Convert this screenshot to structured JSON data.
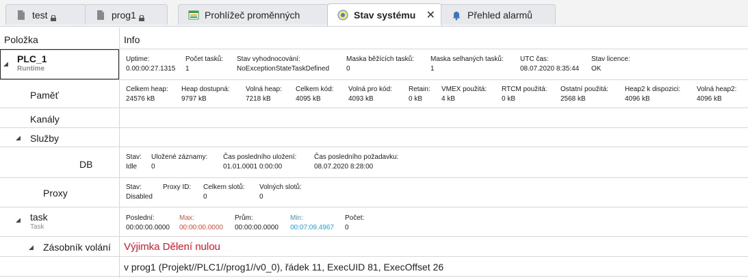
{
  "tabs": [
    {
      "label": "test",
      "locked": true
    },
    {
      "label": "prog1",
      "locked": true
    },
    {
      "label": "Prohlížeč proměnných"
    },
    {
      "label": "Stav systému",
      "active": true
    },
    {
      "label": "Přehled alarmů"
    }
  ],
  "header": {
    "col1": "Položka",
    "col2": "Info"
  },
  "plc": {
    "name": "PLC_1",
    "sub": "Runtime",
    "fields": [
      {
        "label": "Uptime:",
        "value": "0.00:00:27.1315"
      },
      {
        "label": "Počet tasků:",
        "value": "1"
      },
      {
        "label": "Stav vyhodnocování:",
        "value": "NoExceptionStateTaskDefined"
      },
      {
        "label": "Maska běžících tasků:",
        "value": "0"
      },
      {
        "label": "Maska selhaných tasků:",
        "value": "1"
      },
      {
        "label": "UTC čas:",
        "value": "08.07.2020 8:35:44"
      },
      {
        "label": "Stav licence:",
        "value": "OK"
      }
    ]
  },
  "memory": {
    "name": "Paměť",
    "fields": [
      {
        "label": "Celkem heap:",
        "value": "24576 kB"
      },
      {
        "label": "Heap dostupná:",
        "value": "9797 kB"
      },
      {
        "label": "Volná heap:",
        "value": "7218 kB"
      },
      {
        "label": "Celkem kód:",
        "value": "4095 kB"
      },
      {
        "label": "Volná pro kód:",
        "value": "4093 kB"
      },
      {
        "label": "Retain:",
        "value": "0 kB"
      },
      {
        "label": "VMEX použitá:",
        "value": "4 kB"
      },
      {
        "label": "RTCM použitá:",
        "value": "0 kB"
      },
      {
        "label": "Ostatní použitá:",
        "value": "2568 kB"
      },
      {
        "label": "Heap2 k dispozici:",
        "value": "4096 kB"
      },
      {
        "label": "Volná heap2:",
        "value": "4096 kB"
      }
    ]
  },
  "channels": {
    "name": "Kanály"
  },
  "services": {
    "name": "Služby"
  },
  "db": {
    "name": "DB",
    "fields": [
      {
        "label": "Stav:",
        "value": "Idle"
      },
      {
        "label": "Uložené záznamy:",
        "value": "0"
      },
      {
        "label": "Čas posledního uložení:",
        "value": "01.01.0001 0:00:00"
      },
      {
        "label": "Čas posledního požadavku:",
        "value": "08.07.2020 8:28:00"
      }
    ]
  },
  "proxy": {
    "name": "Proxy",
    "fields": [
      {
        "label": "Stav:",
        "value": "Disabled"
      },
      {
        "label": "Proxy ID:",
        "value": ""
      },
      {
        "label": "Celkem slotů:",
        "value": "0"
      },
      {
        "label": "Volných slotů:",
        "value": "0"
      }
    ]
  },
  "task": {
    "name": "task",
    "sub": "Task",
    "fields": [
      {
        "label": "Poslední:",
        "value": "00:00:00.0000"
      },
      {
        "label": "Max:",
        "value": "00:00:00.0000"
      },
      {
        "label": "Prům:",
        "value": "00:00:00.0000"
      },
      {
        "label": "Min:",
        "value": "00:07:09.4967"
      },
      {
        "label": "Počet:",
        "value": "0"
      }
    ]
  },
  "callstack": {
    "name": "Zásobník volání",
    "error": "Výjimka Dělení nulou",
    "trace": "v prog1 (Projekt//PLC1//prog1//v0_0), řádek 11, ExecUID 81, ExecOffset 26"
  },
  "colors": {
    "max": "#e04b3a",
    "min": "#2a9fd8",
    "error": "#e81123"
  }
}
